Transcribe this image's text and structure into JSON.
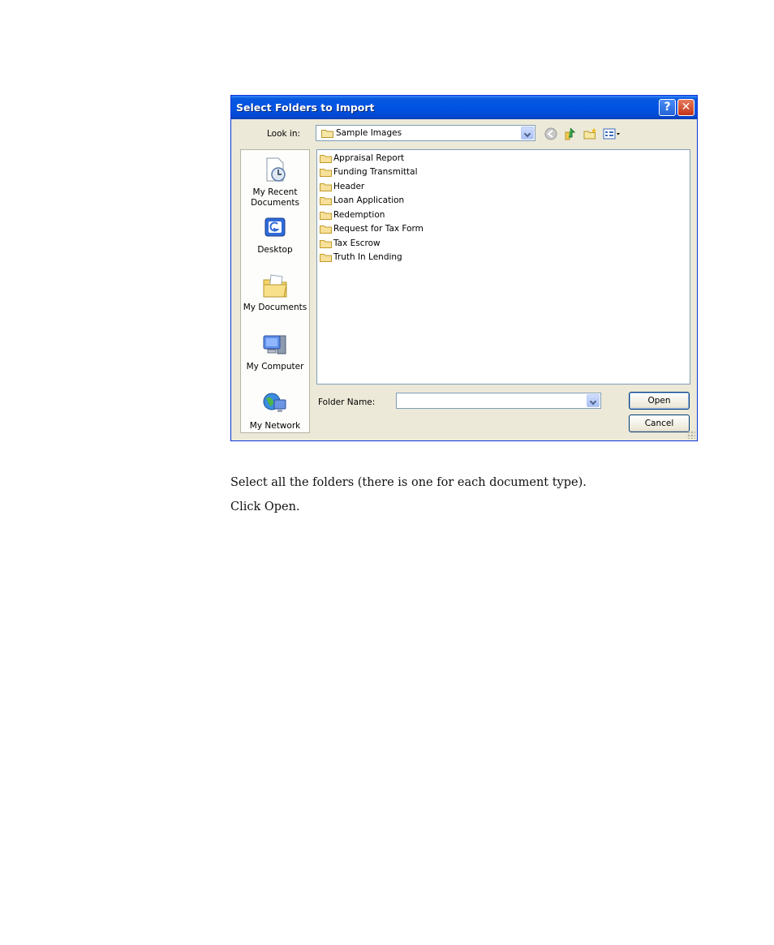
{
  "dialog": {
    "title": "Select Folders to Import",
    "help_symbol": "?",
    "close_symbol": "✕",
    "look_in_label": "Look in:",
    "look_in_value": "Sample Images",
    "places": [
      {
        "label": "My Recent Documents",
        "icon": "recent-documents-icon"
      },
      {
        "label": "Desktop",
        "icon": "desktop-icon"
      },
      {
        "label": "My Documents",
        "icon": "my-documents-icon"
      },
      {
        "label": "My Computer",
        "icon": "my-computer-icon"
      },
      {
        "label": "My Network",
        "icon": "my-network-icon"
      }
    ],
    "folders": [
      "Appraisal Report",
      "Funding Transmittal",
      "Header",
      "Loan Application",
      "Redemption",
      "Request for Tax Form",
      "Tax Escrow",
      "Truth In Lending"
    ],
    "folder_name_label": "Folder Name:",
    "folder_name_value": "",
    "open_label": "Open",
    "cancel_label": "Cancel",
    "toolbar_icons": [
      "back-icon",
      "up-folder-icon",
      "new-folder-icon",
      "views-menu-icon"
    ]
  },
  "instructions": [
    "Select all the folders (there is one for each document type).",
    "Click Open."
  ]
}
